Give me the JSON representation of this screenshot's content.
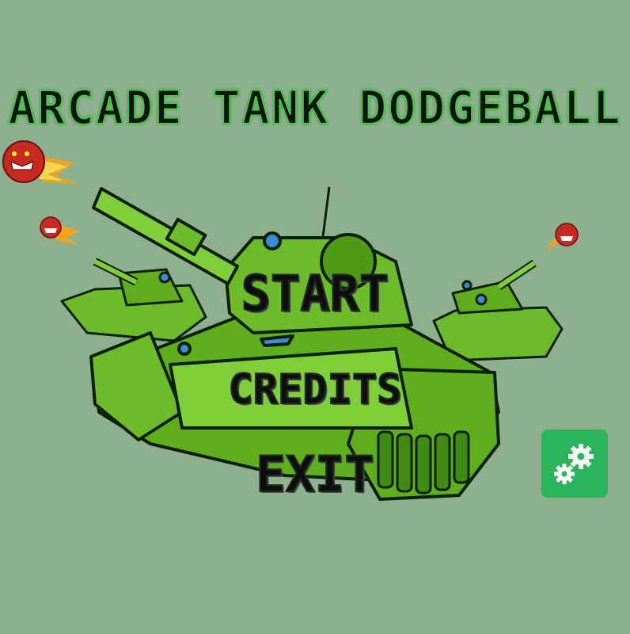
{
  "game": {
    "title": "ARCADE TANK DODGEBALL"
  },
  "menu": {
    "start_label": "START",
    "credits_label": "CREDITS",
    "exit_label": "EXIT"
  },
  "icons": {
    "settings": "gears-icon",
    "ball": "angry-flaming-dodgeball-icon"
  },
  "colors": {
    "background": "#8fb08f",
    "title_outline": "#3bd13b",
    "tank_green": "#5fae1c",
    "settings_button": "#2bb45a"
  }
}
